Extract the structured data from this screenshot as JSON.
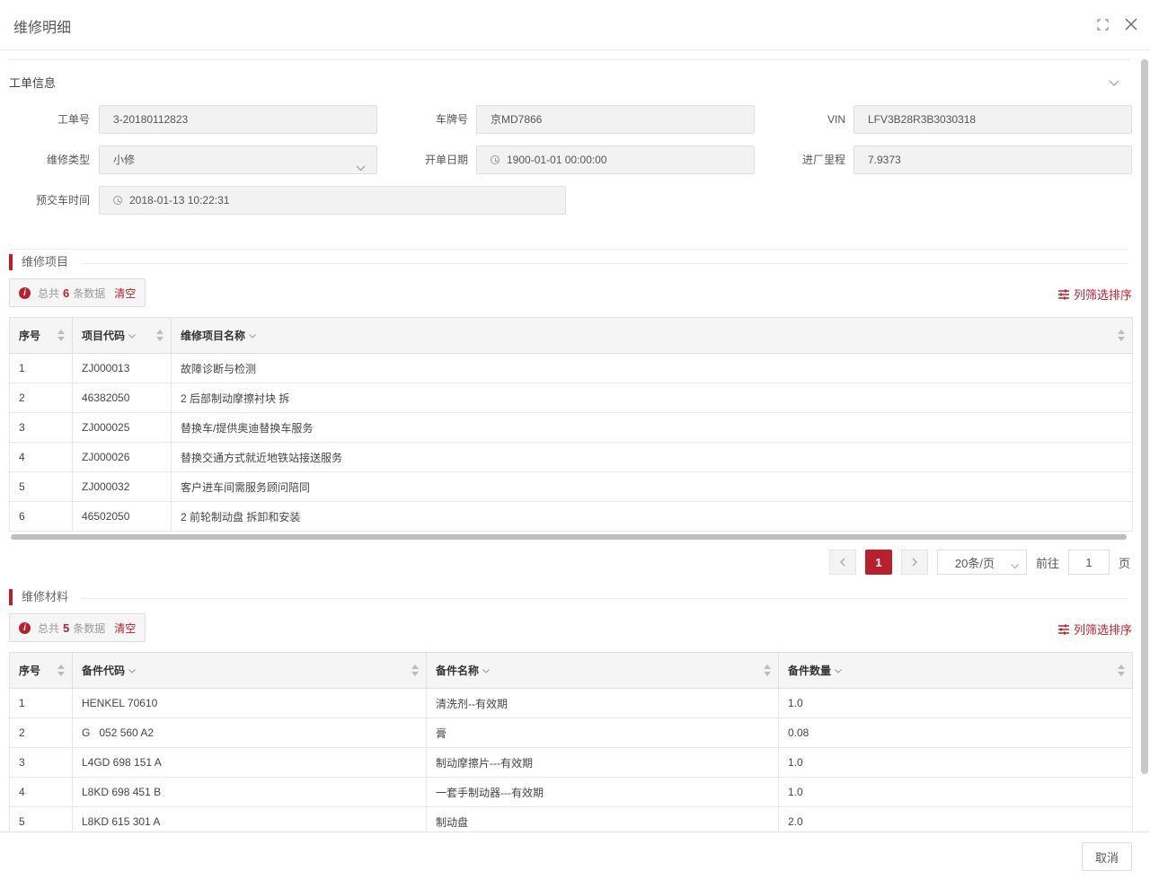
{
  "dialog": {
    "title": "维修明细"
  },
  "work_order": {
    "title": "工单信息",
    "fields": {
      "order_no": {
        "label": "工单号",
        "value": "3-20180112823"
      },
      "plate": {
        "label": "车牌号",
        "value": "京MD7866"
      },
      "vin": {
        "label": "VIN",
        "value": "LFV3B28R3B3030318"
      },
      "repair_type": {
        "label": "维修类型",
        "value": "小修"
      },
      "open_date": {
        "label": "开单日期",
        "value": "1900-01-01 00:00:00"
      },
      "mileage": {
        "label": "进厂里程",
        "value": "7.9373"
      },
      "delivery_time": {
        "label": "预交车时间",
        "value": "2018-01-13 10:22:31"
      }
    }
  },
  "items": {
    "title": "维修项目",
    "info_prefix": "总共",
    "count": "6",
    "info_suffix": "条数据",
    "clear_label": "清空",
    "filter_label": "列筛选排序",
    "columns": [
      "序号",
      "项目代码",
      "维修项目名称"
    ],
    "rows": [
      [
        "1",
        "ZJ000013",
        "故障诊断与检测"
      ],
      [
        "2",
        "46382050",
        "2 后部制动摩擦衬块 拆"
      ],
      [
        "3",
        "ZJ000025",
        "替换车/提供奥迪替换车服务"
      ],
      [
        "4",
        "ZJ000026",
        "替换交通方式就近地铁站接送服务"
      ],
      [
        "5",
        "ZJ000032",
        "客户进车间需服务顾问陪同"
      ],
      [
        "6",
        "46502050",
        "2 前轮制动盘 拆卸和安装"
      ]
    ]
  },
  "pagination": {
    "current_page": "1",
    "page_size": "20条/页",
    "goto_label": "前往",
    "goto_value": "1",
    "page_unit": "页"
  },
  "materials": {
    "title": "维修材料",
    "info_prefix": "总共",
    "count": "5",
    "info_suffix": "条数据",
    "clear_label": "清空",
    "filter_label": "列筛选排序",
    "columns": [
      "序号",
      "备件代码",
      "备件名称",
      "备件数量"
    ],
    "rows": [
      [
        "1",
        "HENKEL 70610",
        "清洗剂--有效期",
        "1.0"
      ],
      [
        "2",
        "G   052 560 A2",
        "膏",
        "0.08"
      ],
      [
        "3",
        "L4GD 698 151 A",
        "制动摩擦片---有效期",
        "1.0"
      ],
      [
        "4",
        "L8KD 698 451 B",
        "一套手制动器---有效期",
        "1.0"
      ],
      [
        "5",
        "L8KD 615 301 A",
        "制动盘",
        "2.0"
      ]
    ]
  },
  "footer": {
    "cancel_label": "取消"
  },
  "colors": {
    "accent": "#b8202e",
    "header_bg": "#f5f5f5",
    "input_bg": "#f2f2f2"
  }
}
